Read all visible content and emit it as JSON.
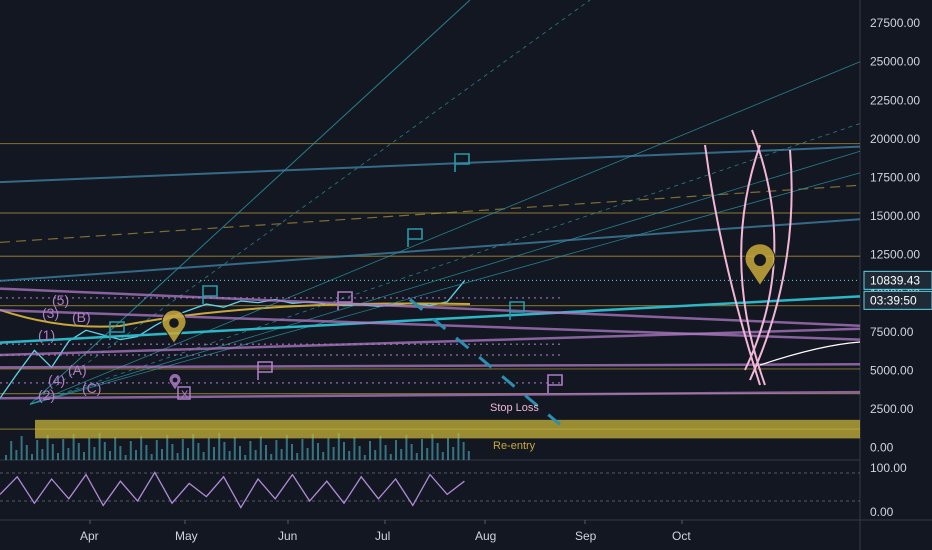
{
  "chart_data": [
    {
      "type": "line",
      "title": "",
      "y_axis": {
        "ticks": [
          "27500.00",
          "25000.00",
          "22500.00",
          "20000.00",
          "17500.00",
          "15000.00",
          "12500.00",
          "10000.00",
          "7500.00",
          "5000.00",
          "2500.00",
          "0.00"
        ],
        "range": [
          -800,
          29000
        ]
      },
      "x_axis": {
        "ticks": [
          "Apr",
          "May",
          "Jun",
          "Jul",
          "Aug",
          "Sep",
          "Oct"
        ]
      },
      "last_price": "10839.43",
      "countdown": "03:39:50",
      "colors": {
        "background": "#131722",
        "price_line": "#5fd4e6",
        "gold": "#c8a93a",
        "purple": "#b07cc6",
        "teal": "#2a9aa8",
        "pink": "#f2b6d6"
      },
      "horizontal_levels": [
        19700,
        15200,
        12400,
        9200,
        5100,
        3500,
        1200
      ],
      "price_series": {
        "x": [
          0.0,
          0.02,
          0.04,
          0.06,
          0.08,
          0.1,
          0.12,
          0.14,
          0.16,
          0.18,
          0.2,
          0.22,
          0.24,
          0.26,
          0.28,
          0.3,
          0.32,
          0.34,
          0.36,
          0.38,
          0.4,
          0.42,
          0.44,
          0.46,
          0.48,
          0.5,
          0.52,
          0.54
        ],
        "y": [
          3200,
          4800,
          6300,
          5200,
          6900,
          7600,
          7300,
          7000,
          7200,
          7900,
          8500,
          8900,
          9300,
          9100,
          9500,
          9400,
          9600,
          9350,
          9450,
          9300,
          9200,
          9250,
          9150,
          9250,
          9350,
          9200,
          9450,
          10800
        ]
      },
      "annotations": {
        "wave_labels": [
          "(5)",
          "(3)",
          "(B)",
          "(1)",
          "(A)",
          "(4)",
          "(C)",
          "(2)"
        ],
        "stop_loss": "Stop Loss",
        "re_entry": "Re-entry",
        "x_marker": "X"
      }
    },
    {
      "type": "line",
      "title": "",
      "y_axis": {
        "ticks": [
          "100.00",
          "0.00"
        ],
        "range": [
          0,
          100
        ]
      },
      "oscillator": {
        "x": [
          0.0,
          0.02,
          0.04,
          0.06,
          0.08,
          0.1,
          0.12,
          0.14,
          0.16,
          0.18,
          0.2,
          0.22,
          0.24,
          0.26,
          0.28,
          0.3,
          0.32,
          0.34,
          0.36,
          0.38,
          0.4,
          0.42,
          0.44,
          0.46,
          0.48,
          0.5,
          0.52,
          0.54
        ],
        "y": [
          40,
          80,
          20,
          75,
          30,
          85,
          15,
          70,
          25,
          90,
          20,
          65,
          35,
          80,
          10,
          75,
          30,
          85,
          25,
          70,
          20,
          80,
          30,
          75,
          15,
          85,
          40,
          70
        ]
      }
    }
  ]
}
